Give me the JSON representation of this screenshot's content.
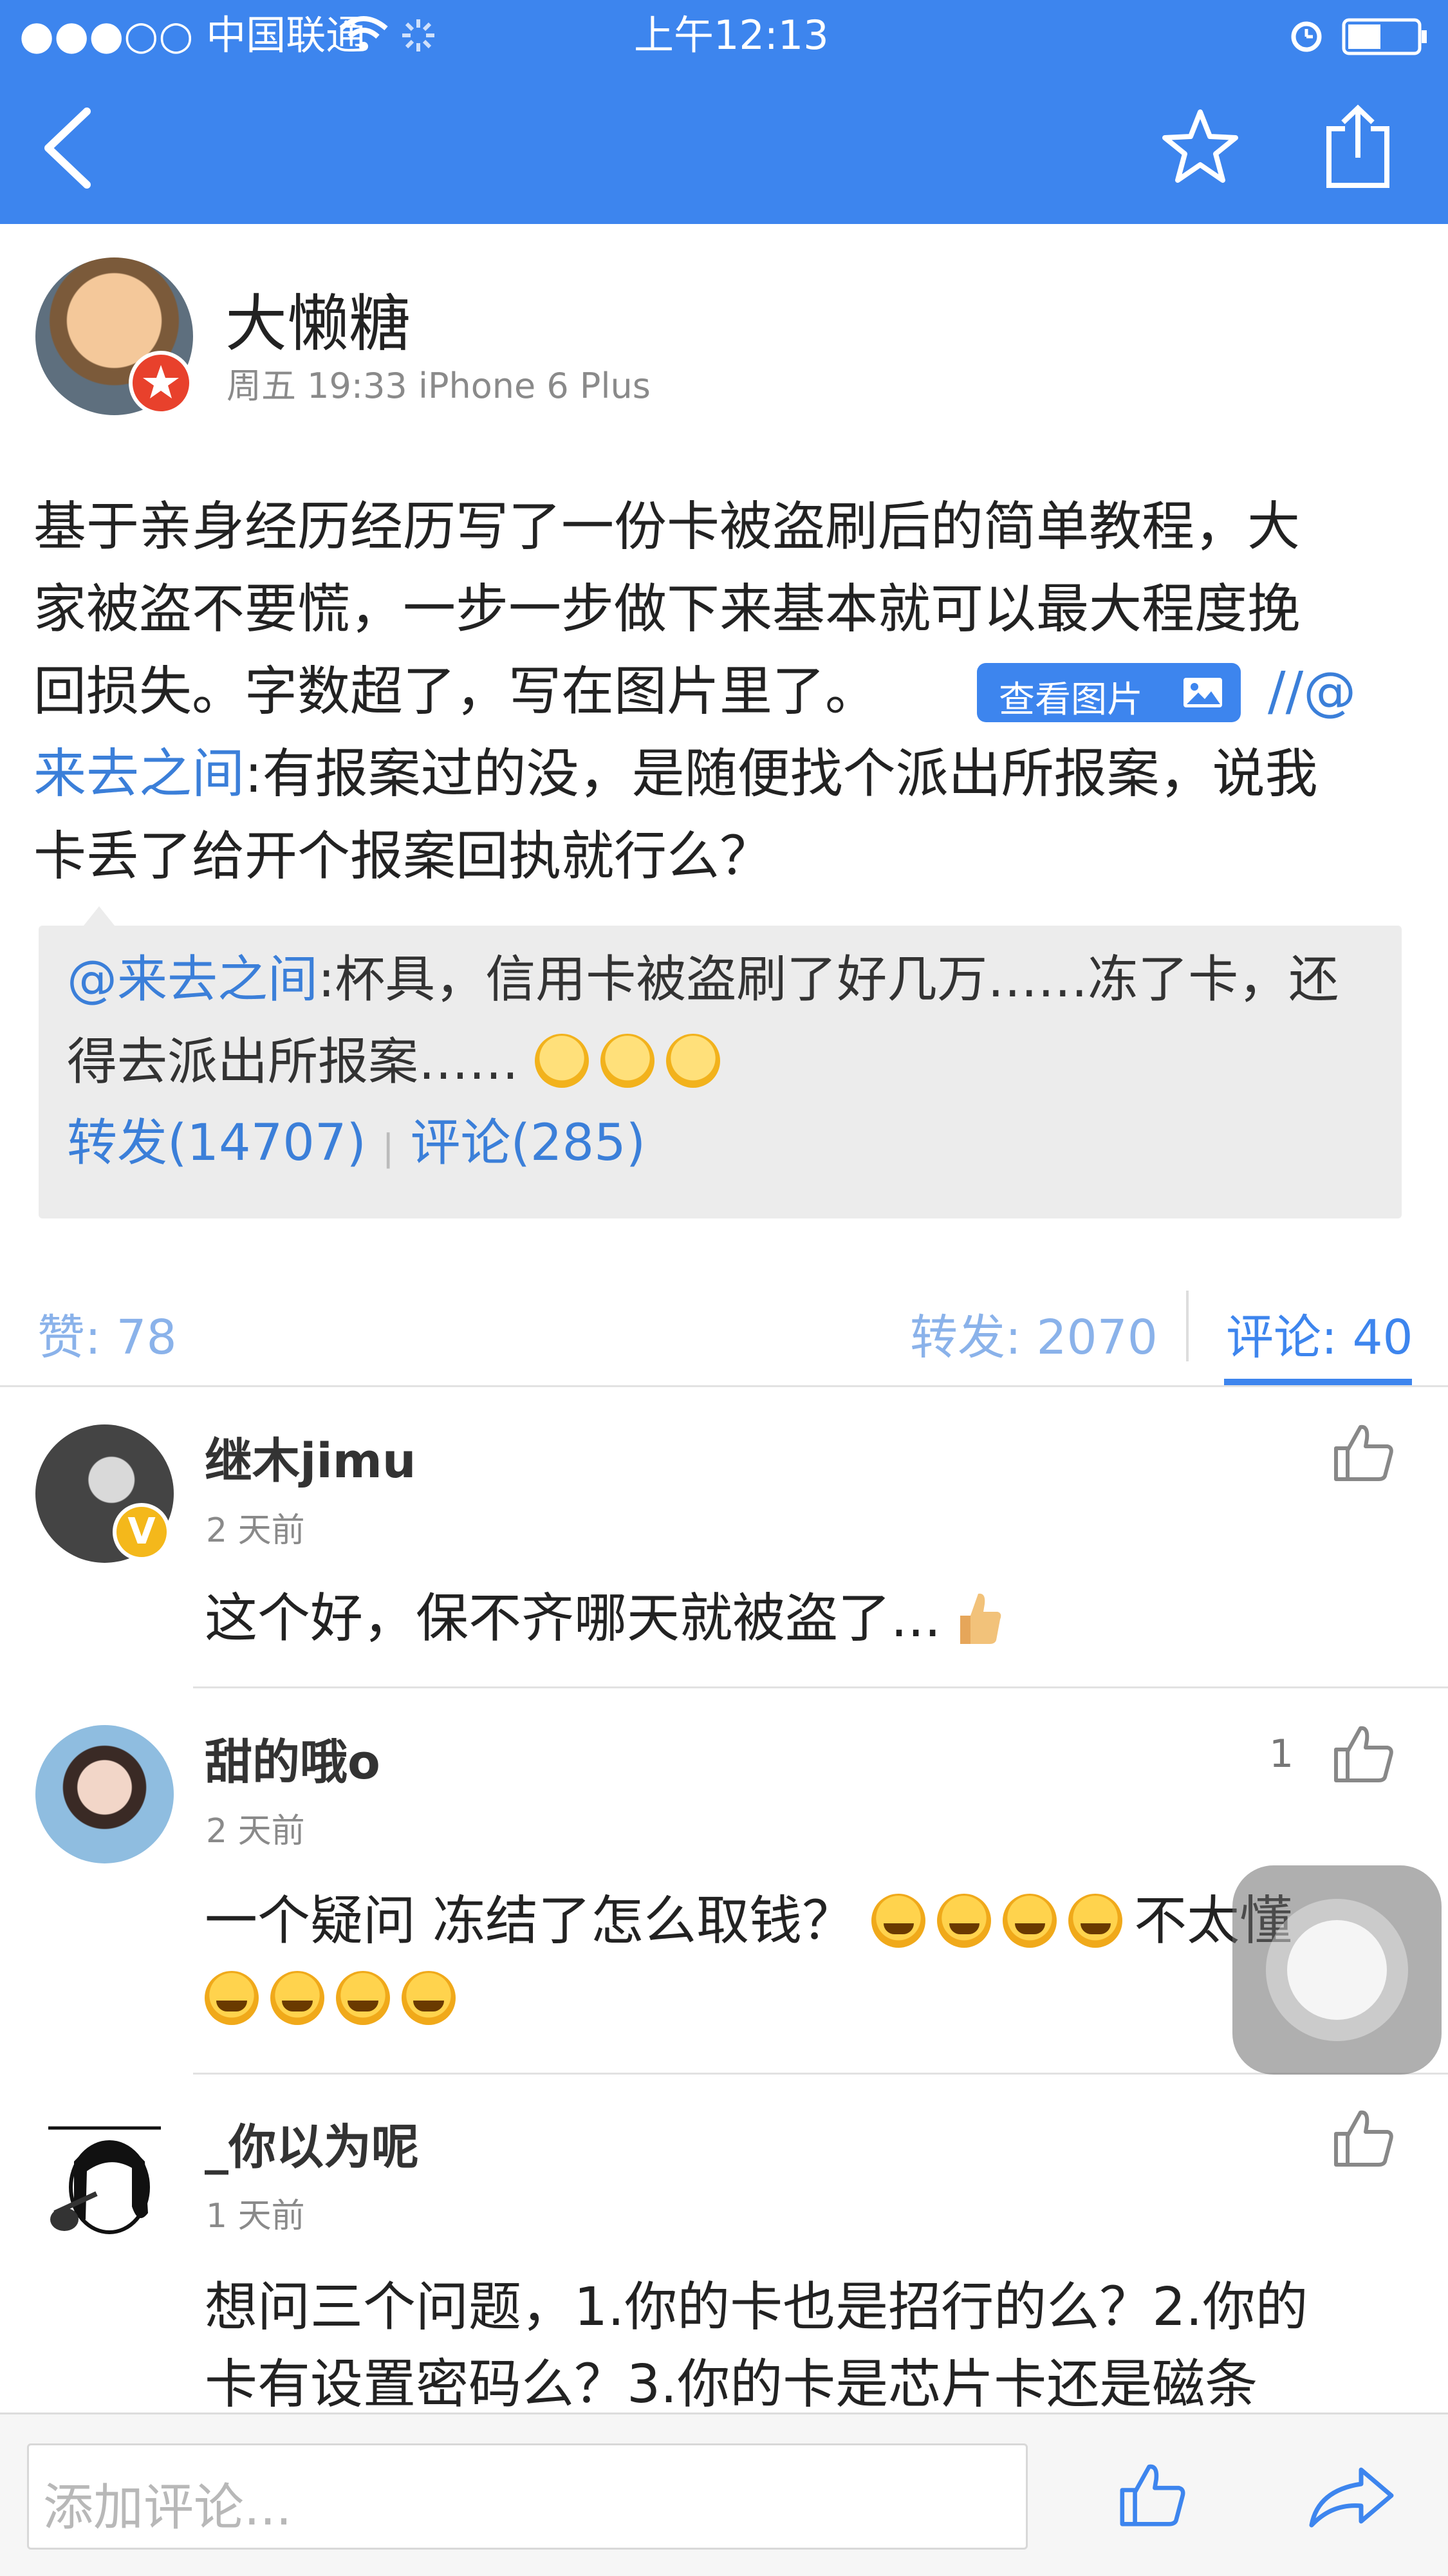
{
  "status_bar": {
    "carrier": "●●●○○ 中国联通",
    "time": "上午12:13"
  },
  "post": {
    "author": "大懒糖",
    "meta": "周五 19:33  iPhone 6 Plus",
    "text_lines": [
      "基于亲身经历经历写了一份卡被盗刷后的简单教程，大",
      "家被盗不要慌，一步一步做下来基本就可以最大程度挽",
      "回损失。字数超了，写在图片里了。"
    ],
    "view_image_label": "查看图片",
    "repost_prefix": "//@",
    "repost_user": "来去之间",
    "repost_text_1": ":有报案过的没，是随便找个派出所报案，说我",
    "repost_text_2": "卡丢了给开个报案回执就行么？"
  },
  "quoted": {
    "user": "@来去之间",
    "text_1": ":杯具，信用卡被盗刷了好几万……冻了卡，还",
    "text_2": "得去派出所报案……",
    "forward": "转发(14707)",
    "sep": "|",
    "comment": "评论(285)"
  },
  "tabs": {
    "likes": "赞: 78",
    "forwards": "转发: 2070",
    "comments": "评论: 40"
  },
  "comments": [
    {
      "name": "继木jimu",
      "time": "2 天前",
      "lines": [
        "这个好，保不齐哪天就被盗了..."
      ],
      "likes": ""
    },
    {
      "name": "甜的哦o",
      "time": "2 天前",
      "lines": [
        "一个疑问 冻结了怎么取钱？",
        "不太懂"
      ],
      "likes": "1"
    },
    {
      "name": "_你以为呢",
      "time": "1 天前",
      "lines": [
        "想问三个问题，1.你的卡也是招行的么？2.你的",
        "卡有设置密码么？3.你的卡是芯片卡还是磁条"
      ],
      "likes": ""
    }
  ],
  "input": {
    "placeholder": "添加评论..."
  },
  "colors": {
    "accent": "#3d85ee",
    "link": "#3b7fd9",
    "tab_inactive": "#8ab2ea"
  }
}
